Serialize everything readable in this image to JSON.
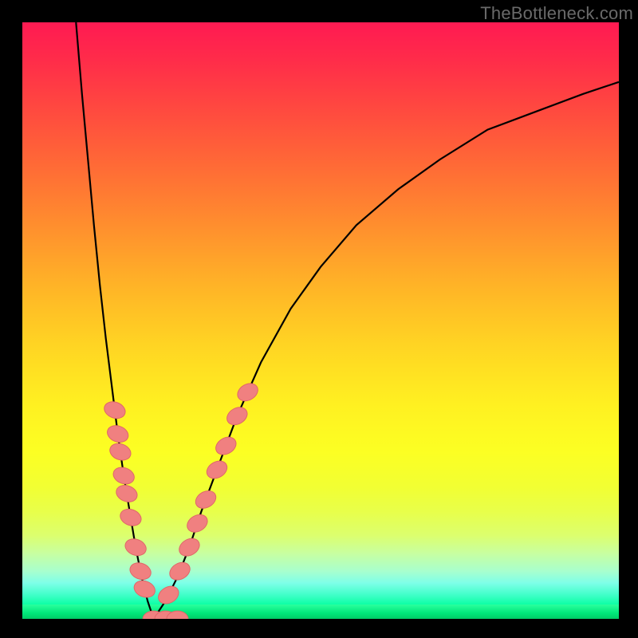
{
  "watermark": "TheBottleneck.com",
  "colors": {
    "frame": "#000000",
    "curve": "#000000",
    "marker_fill": "#f08080",
    "marker_stroke": "#e06868"
  },
  "chart_data": {
    "type": "line",
    "title": "",
    "xlabel": "",
    "ylabel": "",
    "xlim": [
      0,
      100
    ],
    "ylim": [
      0,
      100
    ],
    "x_min_at": 22,
    "series": [
      {
        "name": "left-branch",
        "x": [
          9,
          10,
          11,
          12,
          13,
          14,
          15,
          16,
          17,
          18,
          19,
          20,
          21,
          22
        ],
        "y": [
          100,
          88,
          77,
          66,
          56,
          47,
          39,
          31,
          24,
          18,
          12,
          7,
          3,
          0
        ]
      },
      {
        "name": "right-branch",
        "x": [
          22,
          24,
          26,
          28,
          30,
          33,
          36,
          40,
          45,
          50,
          56,
          63,
          70,
          78,
          86,
          94,
          100
        ],
        "y": [
          0,
          3,
          7,
          12,
          18,
          26,
          34,
          43,
          52,
          59,
          66,
          72,
          77,
          82,
          85,
          88,
          90
        ]
      }
    ],
    "markers": [
      {
        "branch": "left",
        "y_pct": 35
      },
      {
        "branch": "left",
        "y_pct": 31
      },
      {
        "branch": "left",
        "y_pct": 28
      },
      {
        "branch": "left",
        "y_pct": 24
      },
      {
        "branch": "left",
        "y_pct": 21
      },
      {
        "branch": "left",
        "y_pct": 17
      },
      {
        "branch": "left",
        "y_pct": 12
      },
      {
        "branch": "left",
        "y_pct": 8
      },
      {
        "branch": "left",
        "y_pct": 5
      },
      {
        "branch": "min",
        "y_pct": 0
      },
      {
        "branch": "min",
        "y_pct": 0,
        "dx": 2
      },
      {
        "branch": "min",
        "y_pct": 0,
        "dx": 4
      },
      {
        "branch": "right",
        "y_pct": 4
      },
      {
        "branch": "right",
        "y_pct": 8
      },
      {
        "branch": "right",
        "y_pct": 12
      },
      {
        "branch": "right",
        "y_pct": 16
      },
      {
        "branch": "right",
        "y_pct": 20
      },
      {
        "branch": "right",
        "y_pct": 25
      },
      {
        "branch": "right",
        "y_pct": 29
      },
      {
        "branch": "right",
        "y_pct": 34
      },
      {
        "branch": "right",
        "y_pct": 38
      }
    ]
  }
}
